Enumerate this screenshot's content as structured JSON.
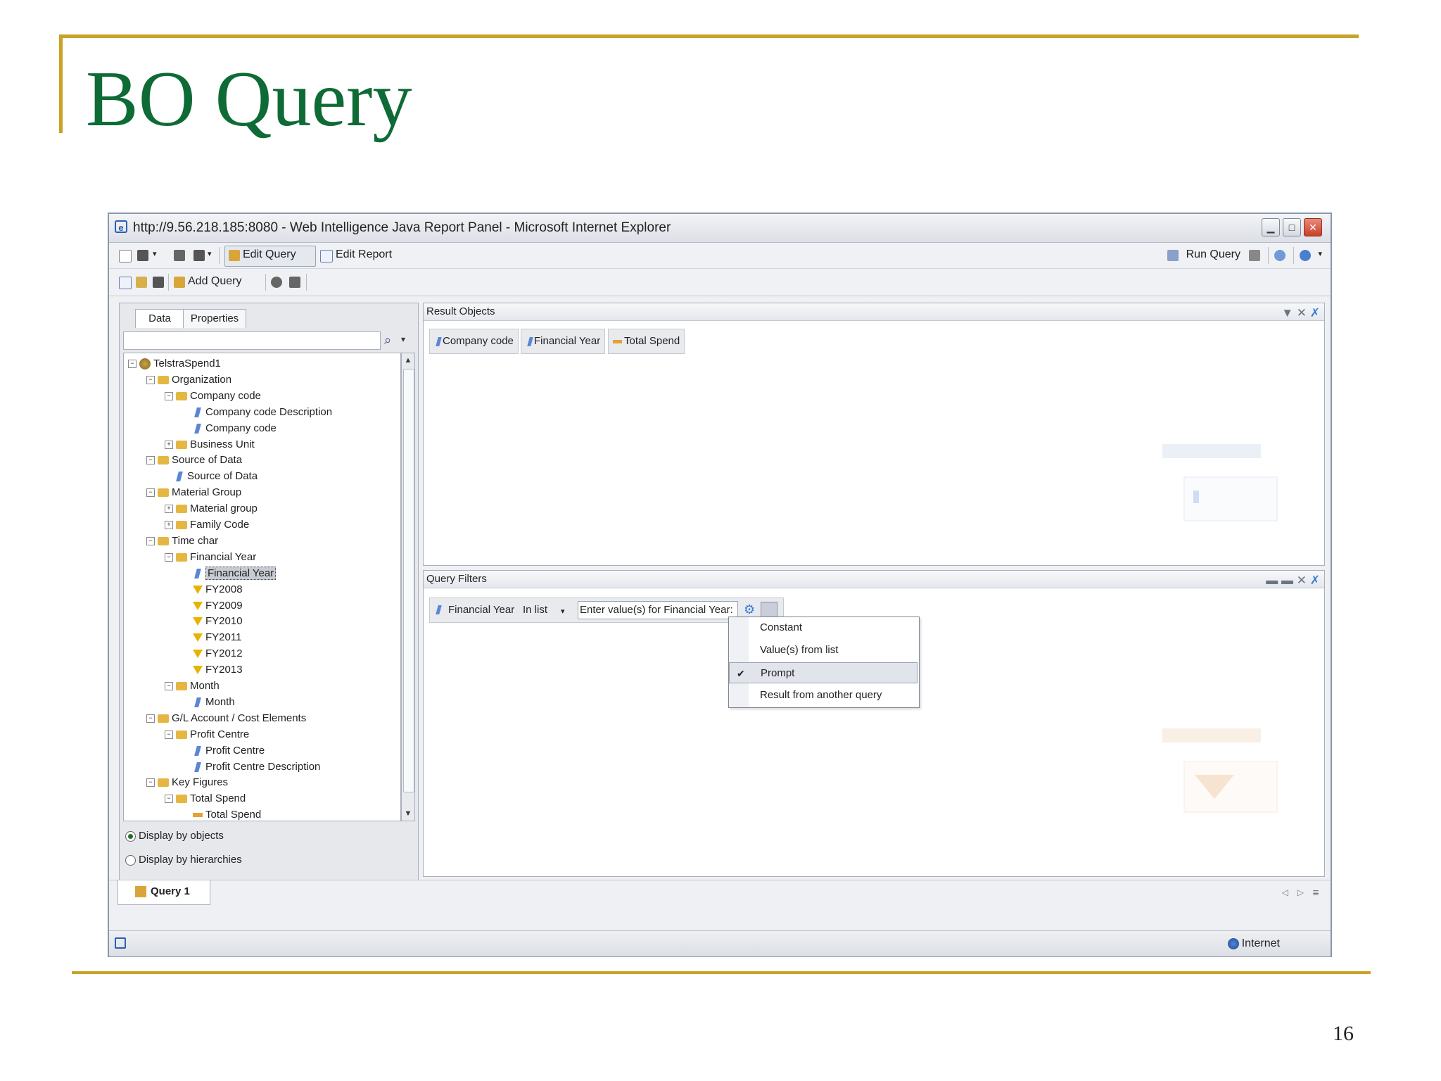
{
  "slide": {
    "title": "BO Query",
    "page_number": "16"
  },
  "window": {
    "title": "http://9.56.218.185:8080 - Web Intelligence Java Report Panel - Microsoft Internet Explorer",
    "icon": "ie-icon"
  },
  "toolbar": {
    "edit_query": "Edit Query",
    "edit_report": "Edit Report",
    "run_query": "Run Query",
    "add_query": "Add Query"
  },
  "left_panel": {
    "tabs": [
      "Data",
      "Properties"
    ],
    "search_placeholder": "",
    "tree": [
      {
        "label": "TelstraSpend1",
        "level": 0,
        "type": "universe",
        "toggle": "−"
      },
      {
        "label": "Organization",
        "level": 1,
        "type": "folder",
        "toggle": "−"
      },
      {
        "label": "Company code",
        "level": 2,
        "type": "folder",
        "toggle": "−"
      },
      {
        "label": "Company code Description",
        "level": 3,
        "type": "dim"
      },
      {
        "label": "Company code",
        "level": 3,
        "type": "dim"
      },
      {
        "label": "Business Unit",
        "level": 2,
        "type": "folder",
        "toggle": "+"
      },
      {
        "label": "Source of Data",
        "level": 1,
        "type": "folder",
        "toggle": "−"
      },
      {
        "label": "Source of Data",
        "level": 2,
        "type": "dim"
      },
      {
        "label": "Material Group",
        "level": 1,
        "type": "folder",
        "toggle": "−"
      },
      {
        "label": "Material group",
        "level": 2,
        "type": "folder",
        "toggle": "+"
      },
      {
        "label": "Family Code",
        "level": 2,
        "type": "folder",
        "toggle": "+"
      },
      {
        "label": "Time char",
        "level": 1,
        "type": "folder",
        "toggle": "−"
      },
      {
        "label": "Financial Year",
        "level": 2,
        "type": "folder",
        "toggle": "−"
      },
      {
        "label": "Financial Year",
        "level": 3,
        "type": "dim",
        "selected": true
      },
      {
        "label": "FY2008",
        "level": 3,
        "type": "filter"
      },
      {
        "label": "FY2009",
        "level": 3,
        "type": "filter"
      },
      {
        "label": "FY2010",
        "level": 3,
        "type": "filter"
      },
      {
        "label": "FY2011",
        "level": 3,
        "type": "filter"
      },
      {
        "label": "FY2012",
        "level": 3,
        "type": "filter"
      },
      {
        "label": "FY2013",
        "level": 3,
        "type": "filter"
      },
      {
        "label": "Month",
        "level": 2,
        "type": "folder",
        "toggle": "−"
      },
      {
        "label": "Month",
        "level": 3,
        "type": "dim"
      },
      {
        "label": "G/L Account / Cost Elements",
        "level": 1,
        "type": "folder",
        "toggle": "−"
      },
      {
        "label": "Profit Centre",
        "level": 2,
        "type": "folder",
        "toggle": "−"
      },
      {
        "label": "Profit Centre",
        "level": 3,
        "type": "dim"
      },
      {
        "label": "Profit Centre Description",
        "level": 3,
        "type": "dim"
      },
      {
        "label": "Key Figures",
        "level": 1,
        "type": "folder",
        "toggle": "−"
      },
      {
        "label": "Total Spend",
        "level": 2,
        "type": "folder",
        "toggle": "−"
      },
      {
        "label": "Total Spend",
        "level": 3,
        "type": "measure"
      }
    ],
    "display_by_objects": "Display by objects",
    "display_by_hierarchies": "Display by hierarchies",
    "display_selected": "objects"
  },
  "result_objects": {
    "header": "Result Objects",
    "items": [
      {
        "label": "Company code",
        "type": "dim"
      },
      {
        "label": "Financial Year",
        "type": "dim"
      },
      {
        "label": "Total Spend",
        "type": "measure"
      }
    ]
  },
  "query_filters": {
    "header": "Query Filters",
    "object": "Financial Year",
    "operator": "In list",
    "prompt_text": "Enter value(s) for Financial Year:",
    "menu": [
      {
        "label": "Constant",
        "checked": false
      },
      {
        "label": "Value(s) from list",
        "checked": false
      },
      {
        "label": "Prompt",
        "checked": true
      },
      {
        "label": "Result from another query",
        "checked": false
      }
    ]
  },
  "bottom": {
    "query_tab": "Query 1"
  },
  "statusbar": {
    "zone": "Internet"
  },
  "colors": {
    "title_green": "#0f6b36",
    "rule_gold": "#c9a227"
  }
}
